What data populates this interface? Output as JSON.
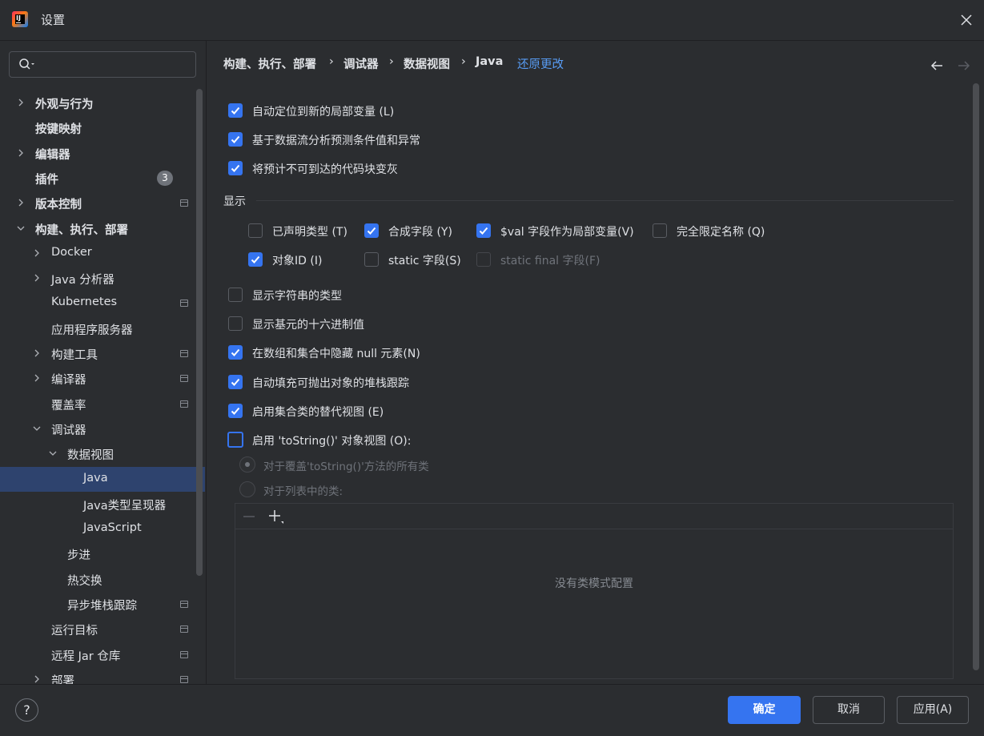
{
  "window": {
    "title": "设置"
  },
  "search": {
    "value": "",
    "placeholder": ""
  },
  "sidebar": {
    "items": [
      {
        "label": "外观与行为",
        "bold": true,
        "chevron": "right"
      },
      {
        "label": "按键映射",
        "bold": true,
        "chevron": "none"
      },
      {
        "label": "编辑器",
        "bold": true,
        "chevron": "right"
      },
      {
        "label": "插件",
        "bold": true,
        "chevron": "none",
        "badge": "3"
      },
      {
        "label": "版本控制",
        "bold": true,
        "chevron": "right",
        "project_icon": true
      },
      {
        "label": "构建、执行、部署",
        "bold": true,
        "chevron": "down"
      },
      {
        "label": "Docker",
        "chevron": "right"
      },
      {
        "label": "Java 分析器",
        "chevron": "right"
      },
      {
        "label": "Kubernetes",
        "chevron": "none",
        "project_icon": true
      },
      {
        "label": "应用程序服务器",
        "chevron": "none"
      },
      {
        "label": "构建工具",
        "chevron": "right",
        "project_icon": true
      },
      {
        "label": "编译器",
        "chevron": "right",
        "project_icon": true
      },
      {
        "label": "覆盖率",
        "chevron": "none",
        "project_icon": true
      },
      {
        "label": "调试器",
        "chevron": "down"
      },
      {
        "label": "数据视图",
        "chevron": "down"
      },
      {
        "label": "Java",
        "chevron": "none",
        "selected": true
      },
      {
        "label": "Java类型呈现器",
        "chevron": "none"
      },
      {
        "label": "JavaScript",
        "chevron": "none"
      },
      {
        "label": "步进",
        "chevron": "none"
      },
      {
        "label": "热交换",
        "chevron": "none"
      },
      {
        "label": "异步堆栈跟踪",
        "chevron": "none",
        "project_icon": true
      },
      {
        "label": "运行目标",
        "chevron": "none",
        "project_icon": true
      },
      {
        "label": "远程 Jar 仓库",
        "chevron": "none",
        "project_icon": true
      },
      {
        "label": "部署",
        "chevron": "right",
        "project_icon": true
      }
    ]
  },
  "breadcrumb": {
    "items": [
      "构建、执行、部署",
      "调试器",
      "数据视图",
      "Java"
    ],
    "separator": "›",
    "revert_label": "还原更改"
  },
  "options_top": [
    {
      "label": "自动定位到新的局部变量 (L)",
      "checked": true
    },
    {
      "label": "基于数据流分析预测条件值和异常",
      "checked": true
    },
    {
      "label": "将预计不可到达的代码块变灰",
      "checked": true
    }
  ],
  "display_section": {
    "title": "显示",
    "row1": [
      {
        "label": "已声明类型 (T)",
        "checked": false
      },
      {
        "label": "合成字段 (Y)",
        "checked": true
      },
      {
        "label": "$val 字段作为局部变量(V)",
        "checked": true
      },
      {
        "label": "完全限定名称 (Q)",
        "checked": false
      }
    ],
    "row2": [
      {
        "label": "对象ID (I)",
        "checked": true
      },
      {
        "label": "static 字段(S)",
        "checked": false
      },
      {
        "label": "static final 字段(F)",
        "checked": false,
        "disabled": true
      }
    ]
  },
  "options_bottom": [
    {
      "label": "显示字符串的类型",
      "checked": false
    },
    {
      "label": "显示基元的十六进制值",
      "checked": false
    },
    {
      "label": "在数组和集合中隐藏 null 元素(N)",
      "checked": true
    },
    {
      "label": "自动填充可抛出对象的堆栈跟踪",
      "checked": true
    },
    {
      "label": "启用集合类的替代视图 (E)",
      "checked": true
    },
    {
      "label": "启用 'toString()' 对象视图 (O):",
      "checked": false,
      "focused": true
    }
  ],
  "tostring_radios": [
    {
      "label": "对于覆盖'toString()'方法的所有类",
      "selected": true,
      "disabled": true
    },
    {
      "label": "对于列表中的类:",
      "selected": false,
      "disabled": true
    }
  ],
  "class_table": {
    "empty_text": "没有类模式配置"
  },
  "footer": {
    "help": "?",
    "ok": "确定",
    "cancel": "取消",
    "apply": "应用(A)"
  },
  "colors": {
    "accent": "#3574f0",
    "link": "#589df6",
    "selection": "#2e436e",
    "background": "#2b2d30"
  },
  "icons": [
    "app-logo-icon",
    "close-icon",
    "search-icon",
    "chevron-right-icon",
    "chevron-down-icon",
    "project-icon",
    "back-arrow-icon",
    "forward-arrow-icon",
    "remove-icon",
    "add-icon",
    "help-icon"
  ]
}
